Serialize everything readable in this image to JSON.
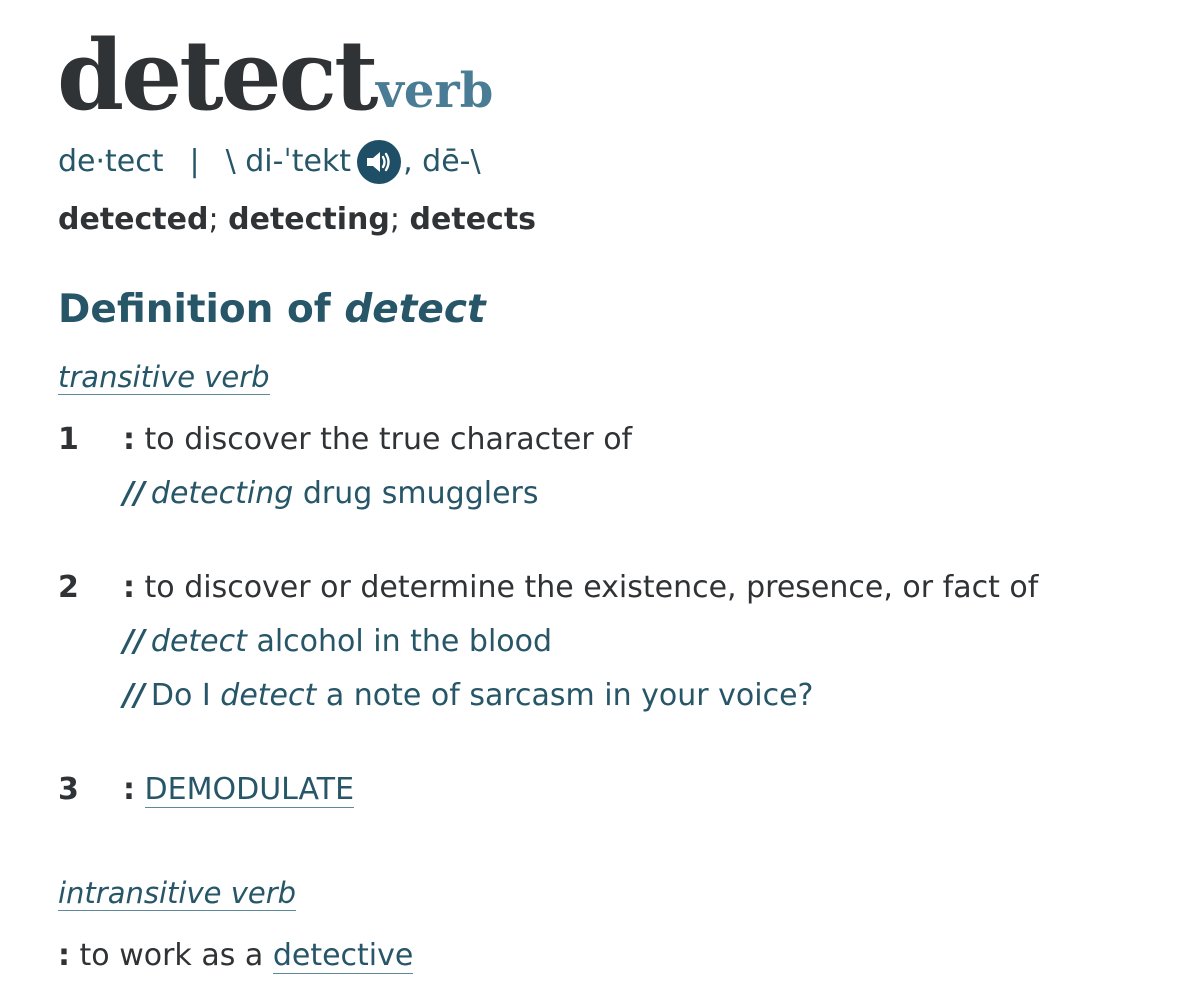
{
  "entry": {
    "headword": "detect",
    "function_label": "verb",
    "hyphenation": "de·tect",
    "separator": "|",
    "pron_open": "\\ di-ˈtekt",
    "pron_close": ", dē-\\",
    "audio_icon": "speaker-icon",
    "inflections": [
      "detected",
      "detecting",
      "detects"
    ],
    "inflection_sep": ";",
    "definition_heading": "Definition of",
    "definition_heading_word": "detect"
  },
  "transitive": {
    "label": "transitive verb",
    "senses": [
      {
        "num": "1",
        "colon": ":",
        "text": "to discover the true character of",
        "examples": [
          {
            "slash": "//",
            "pre": "",
            "em": "detecting",
            "post": " drug smugglers"
          }
        ]
      },
      {
        "num": "2",
        "colon": ":",
        "text": "to discover or determine the existence, presence, or fact of",
        "examples": [
          {
            "slash": "//",
            "pre": "",
            "em": "detect",
            "post": " alcohol in the blood"
          },
          {
            "slash": "//",
            "pre": "Do I ",
            "em": "detect",
            "post": " a note of sarcasm in your voice?"
          }
        ]
      },
      {
        "num": "3",
        "colon": ":",
        "link_text": "DEMODULATE"
      }
    ]
  },
  "intransitive": {
    "label": "intransitive verb",
    "colon": ":",
    "text": "to work as a ",
    "link_text": "detective"
  }
}
